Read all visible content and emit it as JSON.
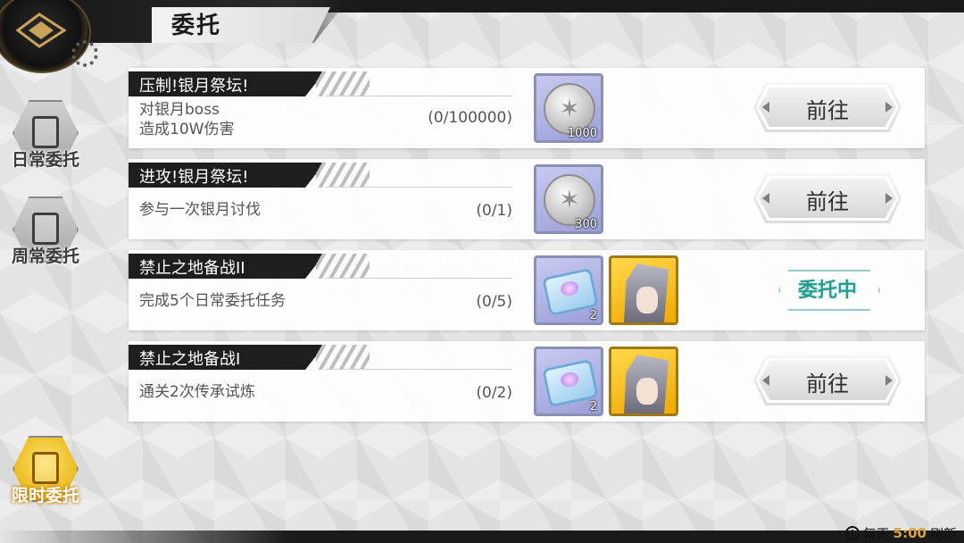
{
  "header": {
    "title": "委托"
  },
  "sidebar": {
    "items": [
      {
        "label": "日常委托",
        "active": false
      },
      {
        "label": "周常委托",
        "active": false
      },
      {
        "label": "限时委托",
        "active": true
      }
    ]
  },
  "tasks": [
    {
      "title": "压制!银月祭坛!",
      "desc_line1": "对银月boss",
      "desc_line2": "造成10W伤害",
      "progress": "(0/100000)",
      "rewards": [
        {
          "icon": "silver-coin-icon",
          "count": "1000"
        }
      ],
      "action": "前往"
    },
    {
      "title": "进攻!银月祭坛!",
      "desc_line1": "参与一次银月讨伐",
      "desc_line2": "",
      "progress": "(0/1)",
      "rewards": [
        {
          "icon": "silver-coin-icon",
          "count": "300"
        }
      ],
      "action": "前往"
    },
    {
      "title": "禁止之地备战II",
      "desc_line1": "完成5个日常委托任务",
      "desc_line2": "",
      "progress": "(0/5)",
      "rewards": [
        {
          "icon": "crystal-chest-icon",
          "count": "2"
        },
        {
          "icon": "character-portrait-icon",
          "count": ""
        }
      ],
      "status": "委托中"
    },
    {
      "title": "禁止之地备战I",
      "desc_line1": "通关2次传承试炼",
      "desc_line2": "",
      "progress": "(0/2)",
      "rewards": [
        {
          "icon": "crystal-chest-icon",
          "count": "2"
        },
        {
          "icon": "character-portrait-icon",
          "count": ""
        }
      ],
      "action": "前往"
    }
  ],
  "footer": {
    "prefix": "每天",
    "time": "5:00",
    "suffix": "刷新"
  },
  "colors": {
    "accent_gold": "#e9b91d",
    "status_teal": "#2a9c8c",
    "refresh_time": "#d9a23a"
  }
}
